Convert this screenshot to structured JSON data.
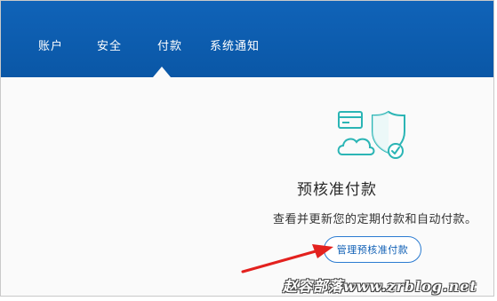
{
  "nav": {
    "items": [
      {
        "label": "账户"
      },
      {
        "label": "安全"
      },
      {
        "label": "付款"
      },
      {
        "label": "系统通知"
      }
    ],
    "active_index": 2
  },
  "main": {
    "title": "预核准付款",
    "description": "查看并更新您的定期付款和自动付款。",
    "manage_button_label": "管理预核准付款"
  },
  "illustration": {
    "icon_name": "card-cloud-shield-check-icon",
    "accent_color": "#2bb5b5"
  },
  "annotation": {
    "arrow_color": "#e3211e"
  },
  "watermark": {
    "text": "赵容部落www.zrblog.net"
  },
  "colors": {
    "header_bg": "#0a59a8",
    "button_border": "#2b7bd1",
    "button_text": "#0f5fb5"
  }
}
